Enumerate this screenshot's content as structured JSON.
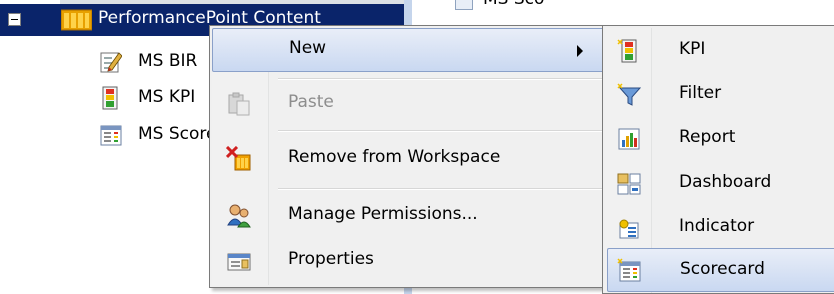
{
  "tree": {
    "root_label": "PerformancePoint Content",
    "items": [
      {
        "label": "MS BIR",
        "icon": "scorecard-pencil-icon"
      },
      {
        "label": "MS KPI",
        "icon": "kpi-icon"
      },
      {
        "label": "MS Scorecard",
        "icon": "scorecard-icon"
      }
    ]
  },
  "right_pane": {
    "partial_label": "MS Scorecard"
  },
  "context_menu": {
    "items": [
      {
        "label": "New",
        "icon": "",
        "state": "highlighted",
        "has_submenu": true
      },
      {
        "label": "Paste",
        "icon": "paste-icon",
        "state": "disabled"
      },
      {
        "label": "Remove from Workspace",
        "icon": "remove-from-workspace-icon",
        "state": "normal"
      },
      {
        "label": "Manage Permissions...",
        "icon": "manage-permissions-icon",
        "state": "normal"
      },
      {
        "label": "Properties",
        "icon": "properties-icon",
        "state": "normal"
      }
    ]
  },
  "submenu": {
    "items": [
      {
        "label": "KPI",
        "icon": "kpi-icon"
      },
      {
        "label": "Filter",
        "icon": "filter-icon"
      },
      {
        "label": "Report",
        "icon": "report-icon"
      },
      {
        "label": "Dashboard",
        "icon": "dashboard-icon"
      },
      {
        "label": "Indicator",
        "icon": "indicator-icon"
      },
      {
        "label": "Scorecard",
        "icon": "scorecard-icon",
        "state": "highlighted"
      }
    ]
  },
  "colors": {
    "selection": "#0a246a",
    "menu_background": "#f0f0f0",
    "menu_highlight": "#c9d8f1",
    "disabled_text": "#8d8d8d"
  }
}
